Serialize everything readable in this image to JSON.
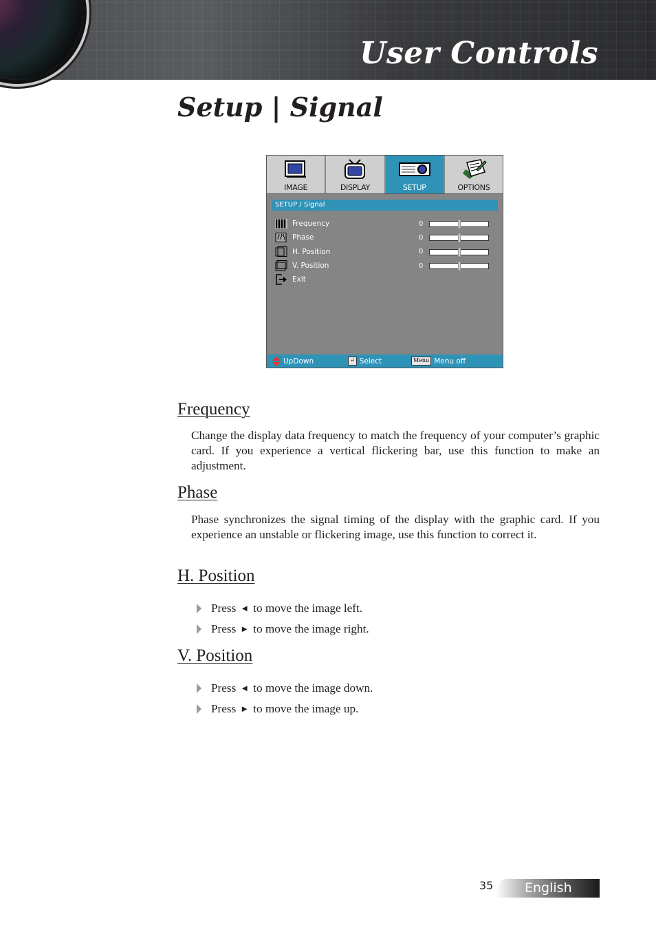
{
  "header": {
    "banner_title": "User Controls",
    "page_title": "Setup | Signal"
  },
  "osd": {
    "tabs": [
      {
        "label": "IMAGE",
        "icon": "monitor-icon",
        "active": false
      },
      {
        "label": "DISPLAY",
        "icon": "tv-icon",
        "active": false
      },
      {
        "label": "SETUP",
        "icon": "projector-icon",
        "active": true
      },
      {
        "label": "OPTIONS",
        "icon": "notepad-icon",
        "active": false
      }
    ],
    "breadcrumb": "SETUP / Signal",
    "rows": [
      {
        "label": "Frequency",
        "icon": "frequency-bars-icon",
        "value": "0",
        "slider": 0.5
      },
      {
        "label": "Phase",
        "icon": "phase-icon",
        "value": "0",
        "slider": 0.5
      },
      {
        "label": "H. Position",
        "icon": "h-position-icon",
        "value": "0",
        "slider": 0.5
      },
      {
        "label": "V. Position",
        "icon": "v-position-icon",
        "value": "0",
        "slider": 0.5
      },
      {
        "label": "Exit",
        "icon": "exit-icon"
      }
    ],
    "footer": {
      "updown": "UpDown",
      "select": "Select",
      "menu_key": "Menu",
      "menu_off": "Menu off"
    },
    "colors": {
      "accent": "#2f93b8",
      "panel": "#858585",
      "tab": "#cfcfcf"
    }
  },
  "sections": {
    "frequency": {
      "heading": "Frequency",
      "text": "Change the display data frequency to match the frequency of your computer’s graphic card. If you experience a vertical flickering bar, use this function to make an adjustment."
    },
    "phase": {
      "heading": "Phase",
      "text": "Phase synchronizes the signal timing of the display with the graphic card. If you experience an unstable or flickering image, use this function to correct it."
    },
    "h_position": {
      "heading": "H. Position",
      "bullets": [
        {
          "pre": "Press",
          "arrow": "◄",
          "post": "to move the image left."
        },
        {
          "pre": "Press",
          "arrow": "►",
          "post": "to move the image right."
        }
      ]
    },
    "v_position": {
      "heading": "V. Position",
      "bullets": [
        {
          "pre": "Press",
          "arrow": "◄",
          "post": "to move the image down."
        },
        {
          "pre": "Press",
          "arrow": "►",
          "post": "to move the image up."
        }
      ]
    }
  },
  "page_footer": {
    "page_number": "35",
    "language": "English"
  }
}
